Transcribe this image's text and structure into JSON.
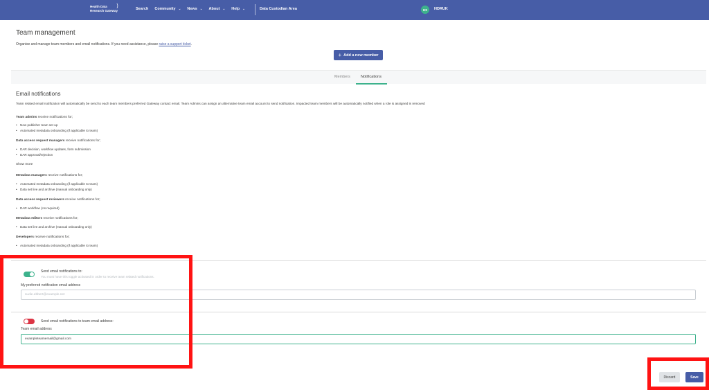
{
  "topbar": {
    "logo_line1": "Health Data",
    "logo_line2": "Research Gateway",
    "nav": [
      "Search",
      "Community",
      "News",
      "About",
      "Help"
    ],
    "area": "Data Custodian Area",
    "avatar_initials": "HS",
    "user": "HDRUK",
    "bg_color": "#475da7"
  },
  "team": {
    "title": "Team management",
    "desc": "Organise and manage team members and email notifications. If you need assistance, please",
    "link": "raise a support ticket",
    "desc_end": ".",
    "add_button": "Add a new member"
  },
  "tabs": [
    "Members",
    "Notifications"
  ],
  "active_tab": "Notifications",
  "notifications": {
    "title": "Email notifications",
    "intro": "Team related email notification will automatically be send to each team members preferred Gateway contact email. Team Admins can assign an alternative team email account to send notification. Impacted team members will be automatically notified when a role is assigned is removed",
    "roles": [
      {
        "name": "Team admins",
        "suffix": "receive notifications for;",
        "items": [
          "New publisher team set up",
          "Automated metadata onboarding (if applicable to team)"
        ]
      },
      {
        "name": "Data access request managers",
        "suffix": "receive notifications for;",
        "items": [
          "DAR decision, workflow updates, form submission",
          "DAR approval/rejection"
        ]
      },
      {
        "name": "Metadata managers",
        "suffix": "receive notifications for;",
        "items": [
          "Automated metadata onboarding (if applicable to team)",
          "Data set live and archive (manual onboarding only)"
        ]
      },
      {
        "name": "Data access request reviewers",
        "suffix": "receive notifications for;",
        "items": [
          "DAR workflow (As required)"
        ]
      },
      {
        "name": "Metadata editors",
        "suffix": "receive notifications for;",
        "items": [
          "Data set live and archive (manual onboarding only)"
        ]
      },
      {
        "name": "Developers",
        "suffix": "receive notifications for;",
        "items": [
          "Automated metadata onboarding (if applicable to team)"
        ]
      }
    ],
    "show_more": "Show more",
    "personal": {
      "toggle_label": "Send email notifications to:",
      "toggle_hint": "You must have this toggle activated in order to receive team related notifications.",
      "toggle_on": true,
      "field_label": "My preferred notification email address",
      "field_value": "sudie.ebbert@example.net"
    },
    "team_email": {
      "toggle_label": "Send email notifications to team email address:",
      "toggle_on": false,
      "field_label": "Team email address",
      "field_value": "exampleteamemail@gmail.com"
    }
  },
  "actions": {
    "discard": "Discard",
    "save": "Save"
  },
  "colors": {
    "accent": "#475da7",
    "success": "#3db28c",
    "danger": "#dc3545",
    "highlight": "#ff1313"
  }
}
